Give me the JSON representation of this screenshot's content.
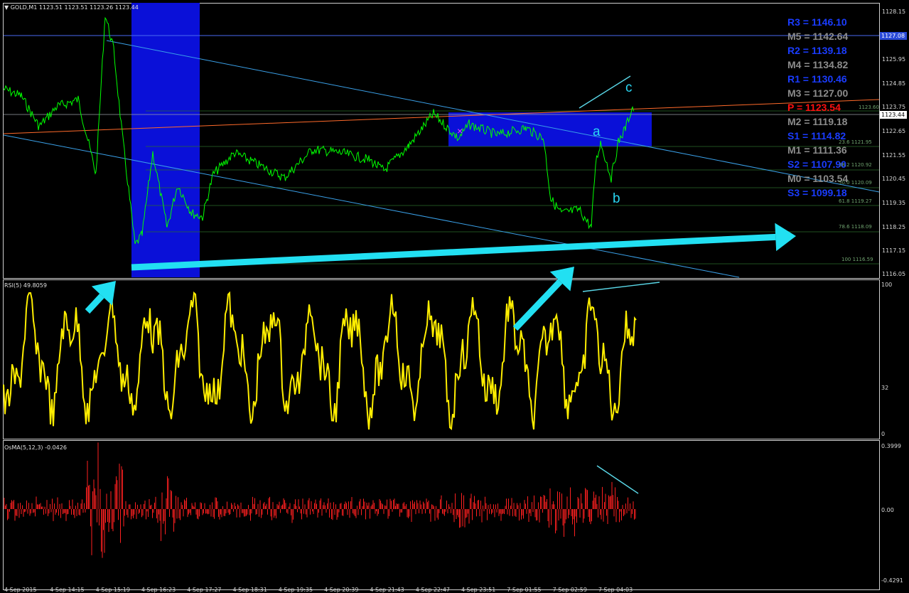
{
  "main_chart": {
    "info": "GOLD,M1  1123.51 1123.51 1123.26 1123.44",
    "price_scale": [
      "1128.15",
      "1127.08",
      "1125.95",
      "1124.85",
      "1123.75",
      "1123.44",
      "1122.65",
      "1121.55",
      "1120.45",
      "1119.35",
      "1118.25",
      "1117.15",
      "1116.05"
    ],
    "current_price_tag": "1123.44",
    "hline_price_tag": "1127.08",
    "pivots": [
      {
        "label": "R3 = 1146.10",
        "color": "blue"
      },
      {
        "label": "M5 = 1142.64",
        "color": "gray"
      },
      {
        "label": "R2 = 1139.18",
        "color": "blue"
      },
      {
        "label": "M4 = 1134.82",
        "color": "gray"
      },
      {
        "label": "R1 = 1130.46",
        "color": "blue"
      },
      {
        "label": "M3 = 1127.00",
        "color": "gray"
      },
      {
        "label": "P  = 1123.54",
        "color": "red"
      },
      {
        "label": "M2 = 1119.18",
        "color": "gray"
      },
      {
        "label": "S1 = 1114.82",
        "color": "blue"
      },
      {
        "label": "M1 = 1111.36",
        "color": "gray"
      },
      {
        "label": "S2 = 1107.90",
        "color": "blue"
      },
      {
        "label": "M0 = 1103.54",
        "color": "gray"
      },
      {
        "label": "S3 = 1099.18",
        "color": "blue"
      }
    ],
    "fib_levels": [
      "1123.60",
      "23.6 1121.95",
      "38.2 1120.92",
      "50.0 1120.09",
      "61.8 1119.27",
      "78.6 1118.09",
      "100 1116.59"
    ],
    "wave_labels": [
      "a",
      "b",
      "c"
    ],
    "cross_mark": "×"
  },
  "rsi": {
    "info": "RSI(5) 49.8059",
    "scale": [
      "100",
      "32",
      "0"
    ]
  },
  "osma": {
    "info": "OsMA(5,12,3) -0.0426",
    "scale": [
      "0.3999",
      "0.00",
      "-0.4291"
    ]
  },
  "time_axis": [
    "4 Sep 2015",
    "4 Sep 14:15",
    "4 Sep 15:19",
    "4 Sep 16:23",
    "4 Sep 17:27",
    "4 Sep 18:31",
    "4 Sep 19:35",
    "4 Sep 20:39",
    "4 Sep 21:43",
    "4 Sep 22:47",
    "4 Sep 23:51",
    "7 Sep 01:55",
    "7 Sep 02:59",
    "7 Sep 04:03"
  ],
  "colors": {
    "price_line": "#00ff00",
    "rsi_line": "#ffee00",
    "osma_hist": "#ff2020",
    "arrow": "#22e0f2",
    "zone": "#0a10d8",
    "trendline": "#3aa0e8",
    "pivot_line": "#ff6a2a"
  }
}
